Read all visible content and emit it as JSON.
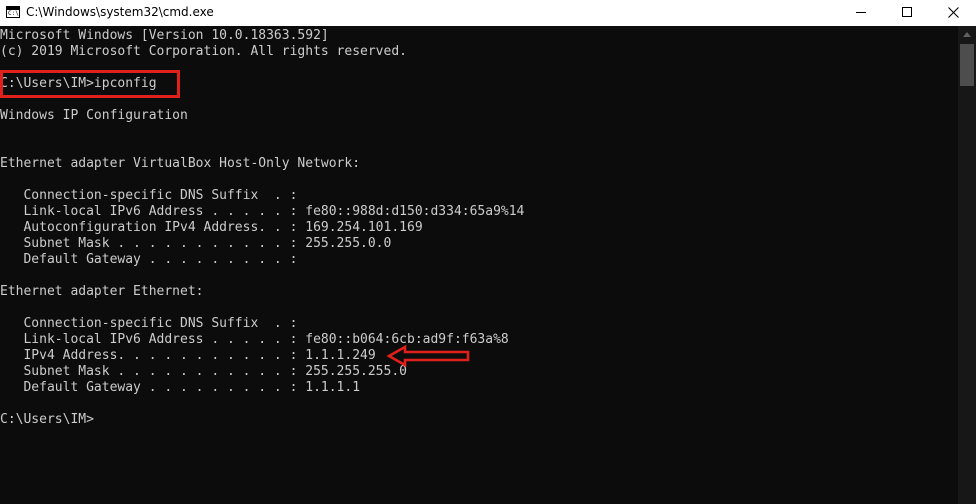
{
  "window": {
    "title": "C:\\Windows\\system32\\cmd.exe",
    "icon_prompt": "C:\\",
    "icon": "cmd-icon",
    "buttons": {
      "minimize": "minimize-icon",
      "maximize": "maximize-icon",
      "close": "close-icon"
    }
  },
  "console": {
    "lines": [
      "Microsoft Windows [Version 10.0.18363.592]",
      "(c) 2019 Microsoft Corporation. All rights reserved.",
      "",
      "C:\\Users\\IM>ipconfig",
      "",
      "Windows IP Configuration",
      "",
      "",
      "Ethernet adapter VirtualBox Host-Only Network:",
      "",
      "   Connection-specific DNS Suffix  . :",
      "   Link-local IPv6 Address . . . . . : fe80::988d:d150:d334:65a9%14",
      "   Autoconfiguration IPv4 Address. . : 169.254.101.169",
      "   Subnet Mask . . . . . . . . . . . : 255.255.0.0",
      "   Default Gateway . . . . . . . . . :",
      "",
      "Ethernet adapter Ethernet:",
      "",
      "   Connection-specific DNS Suffix  . :",
      "   Link-local IPv6 Address . . . . . : fe80::b064:6cb:ad9f:f63a%8",
      "   IPv4 Address. . . . . . . . . . . : 1.1.1.249",
      "   Subnet Mask . . . . . . . . . . . : 255.255.255.0",
      "   Default Gateway . . . . . . . . . : 1.1.1.1",
      "",
      "C:\\Users\\IM>"
    ]
  },
  "annotations": {
    "highlight_color": "#e0201b",
    "arrow_icon": "left-arrow-icon"
  },
  "colors": {
    "console_background": "#0c0c0c",
    "console_text": "#cccccc",
    "titlebar_background": "#ffffff"
  }
}
